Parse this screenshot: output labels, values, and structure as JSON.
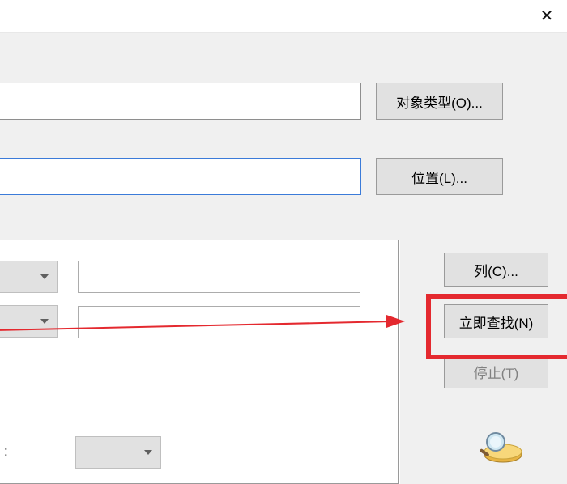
{
  "titlebar": {
    "close_glyph": "✕"
  },
  "upper": {
    "input1_value": "",
    "input2_value": "",
    "object_type_btn": "对象类型(O)...",
    "location_btn": "位置(L)..."
  },
  "mid": {
    "combo1_value": "",
    "combo2_value": "",
    "input3_value": "",
    "input4_value": "",
    "combo3_value": ""
  },
  "actions": {
    "columns_btn": "列(C)...",
    "find_now_btn": "立即查找(N)",
    "stop_btn": "停止(T)"
  },
  "bottom_mark": ":",
  "icons": {
    "close": "close-icon",
    "chevron_down": "chevron-down-icon",
    "search_folder": "search-folder-icon"
  }
}
